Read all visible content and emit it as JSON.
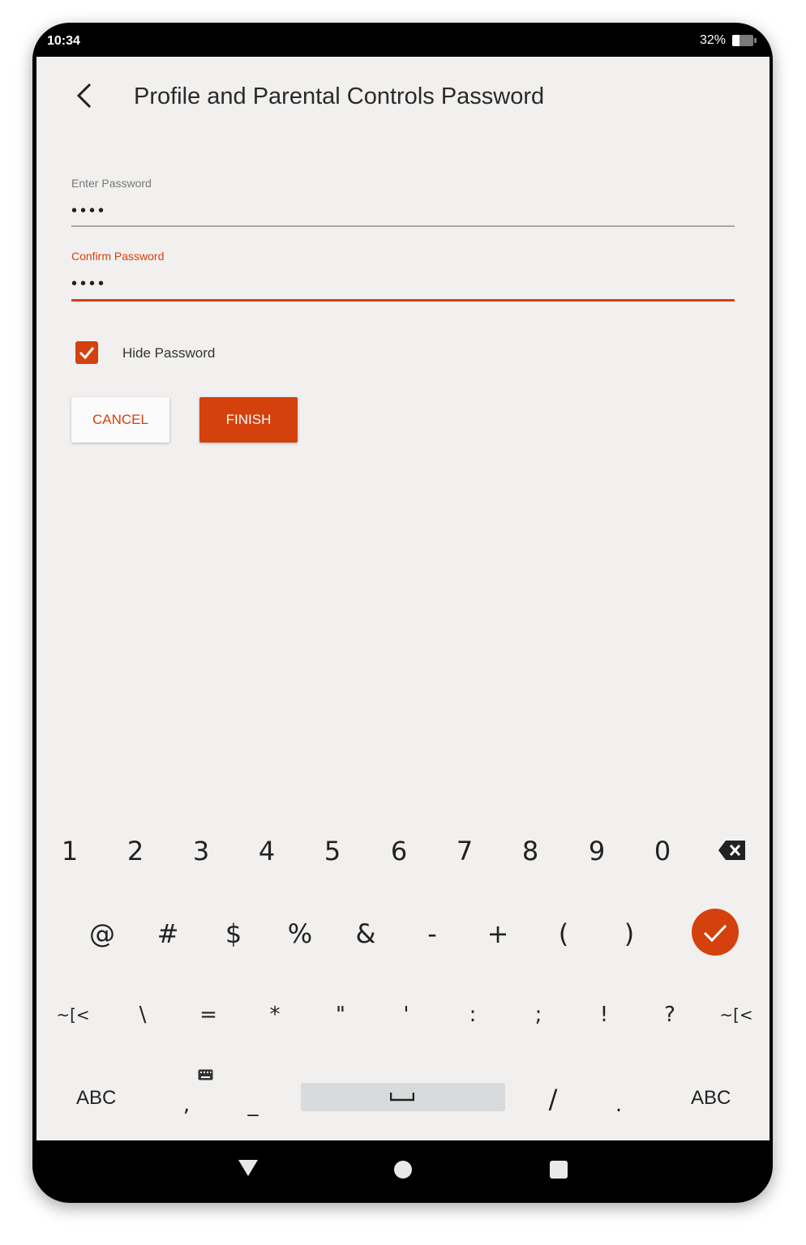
{
  "status": {
    "time": "10:34",
    "battery": "32%"
  },
  "header": {
    "title": "Profile and Parental Controls Password"
  },
  "form": {
    "enter_label": "Enter Password",
    "enter_value": "••••",
    "confirm_label": "Confirm Password",
    "confirm_value": "••••",
    "hide_label": "Hide Password",
    "hide_checked": true
  },
  "buttons": {
    "cancel": "CANCEL",
    "finish": "FINISH"
  },
  "keyboard": {
    "row1": [
      "1",
      "2",
      "3",
      "4",
      "5",
      "6",
      "7",
      "8",
      "9",
      "0"
    ],
    "row2": [
      "@",
      "#",
      "$",
      "%",
      "&",
      "-",
      "+",
      "(",
      ")"
    ],
    "row3": [
      "~[<",
      "\\",
      "=",
      "*",
      "\"",
      "'",
      ":",
      ";",
      "!",
      "?",
      "~[<"
    ],
    "row4_left": "ABC",
    "row4_right": "ABC",
    "row4_keys": [
      ",",
      "_",
      "/",
      "."
    ]
  },
  "colors": {
    "accent": "#d4410c",
    "screen_bg": "#f1f0ef"
  }
}
